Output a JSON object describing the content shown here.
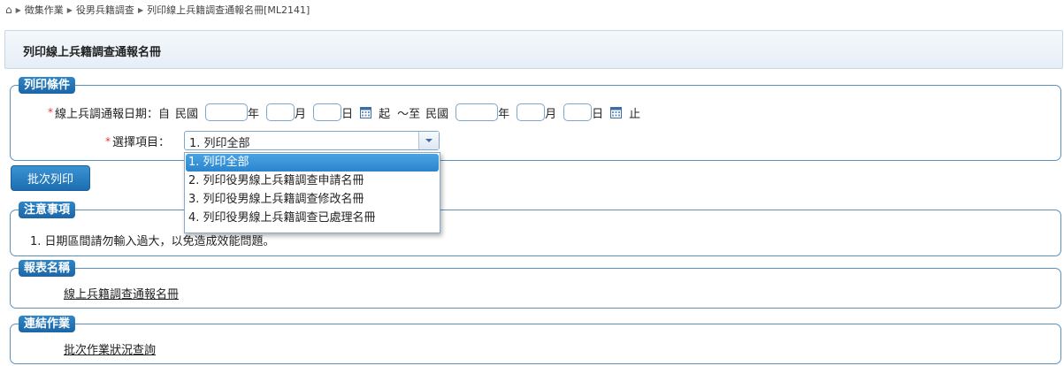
{
  "breadcrumb": {
    "items": [
      "徵集作業",
      "役男兵籍調查",
      "列印線上兵籍調查通報名冊[ML2141]"
    ]
  },
  "page": {
    "title": "列印線上兵籍調查通報名冊"
  },
  "print_conditions": {
    "legend": "列印條件",
    "date_label": "線上兵調通報日期：自",
    "era": "民國",
    "year": "年",
    "month": "月",
    "day": "日",
    "from": "起",
    "to": "～至",
    "end": "止",
    "from_year": "",
    "from_month": "",
    "from_day": "",
    "to_year": "",
    "to_month": "",
    "to_day": "",
    "item_label": "選擇項目：",
    "selected_item": "1. 列印全部",
    "required_mark": "*"
  },
  "dropdown": {
    "options": [
      "1. 列印全部",
      "2. 列印役男線上兵籍調查申請名冊",
      "3. 列印役男線上兵籍調查修改名冊",
      "4. 列印役男線上兵籍調查已處理名冊"
    ]
  },
  "batch_print": {
    "label": "批次列印"
  },
  "notes": {
    "legend": "注意事項",
    "text": "1. 日期區間請勿輸入過大，以免造成效能問題。"
  },
  "report_name": {
    "legend": "報表名稱",
    "link": "線上兵籍調查通報名冊"
  },
  "related": {
    "legend": "連結作業",
    "link": "批次作業狀況查詢"
  },
  "colors": {
    "accent": "#1f6fb2",
    "required": "#e23b3b"
  }
}
